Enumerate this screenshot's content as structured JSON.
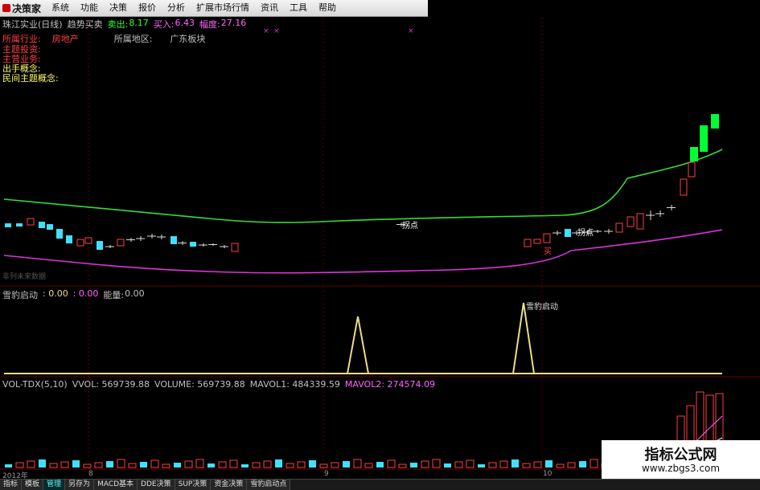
{
  "menubar": {
    "logo": "决策家",
    "items": [
      "系统",
      "功能",
      "决策",
      "报价",
      "分析",
      "扩展市场行情",
      "资讯",
      "工具",
      "帮助"
    ]
  },
  "stock": {
    "name": "珠江实业(日线)",
    "indicator": "趋势买卖",
    "sell_label": "卖出:",
    "sell_value": "8.17",
    "buy_label": "买入:",
    "buy_value": "6.43",
    "amp_label": "幅度:",
    "amp_value": "27.16"
  },
  "info": {
    "industry_label": "所属行业:",
    "industry_value": "房地产",
    "region_label": "所属地区:",
    "region_value": "广东板块",
    "theme_label": "主题投资:",
    "business_label": "主营业务:",
    "concept_label": "出手概念:",
    "folk_label": "民间主题概念:"
  },
  "main_chart": {
    "future_label": "非列未来数据",
    "annotation_1": "拐点",
    "annotation_2": "拐点",
    "annotation_3": "买"
  },
  "indicator_pane": {
    "name": "雪豹启动",
    "v1": ": 0.00",
    "v2": ": 0.00",
    "energy_label": "能量:",
    "energy_value": "0.00",
    "annotation": "雪豹启动"
  },
  "volume_pane": {
    "name": "VOL-TDX(5,10)",
    "vvol": "VVOL: 569739.88",
    "volume": "VOLUME: 569739.88",
    "mavol1": "MAVOL1: 484339.59",
    "mavol2": "MAVOL2: 274574.09"
  },
  "time_axis": {
    "year": "2012年",
    "m8": "8",
    "m9": "9",
    "m10": "10"
  },
  "bottom_tabs": [
    "指标",
    "模板",
    "管理",
    "另存为",
    "MACD基本",
    "DDE决策",
    "SUP决策",
    "资金决策",
    "雪豹启动点"
  ],
  "watermark": {
    "title": "指标公式网",
    "url": "www.zbgs3.com"
  },
  "colors": {
    "up": "#ff4040",
    "down": "#40e0ff",
    "strong_up": "#00ff33",
    "ma_green": "#33dd33",
    "ma_magenta": "#dd33dd",
    "signal": "#eedd88"
  }
}
